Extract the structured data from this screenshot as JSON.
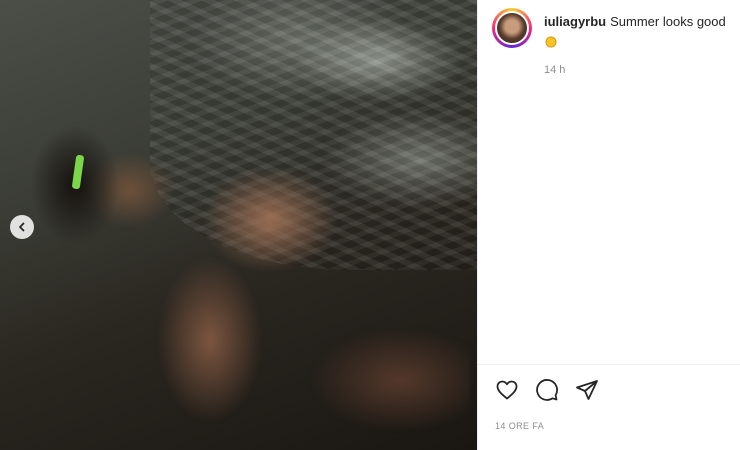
{
  "post": {
    "username": "iuliagyrbu",
    "caption_text": "Summer looks good",
    "caption_emoji_icon": "sun-emoji-icon",
    "caption_relative_time": "14 h",
    "post_timestamp": "14 ORE FA"
  },
  "actions": {
    "icons": [
      "heart-icon",
      "comment-icon",
      "share-icon"
    ]
  },
  "colors": {
    "text": "#262626",
    "secondary_text": "#8e8e8e",
    "divider": "#efefef",
    "story_ring": [
      "#f9ce34",
      "#ee2a7b",
      "#6228d7"
    ]
  }
}
